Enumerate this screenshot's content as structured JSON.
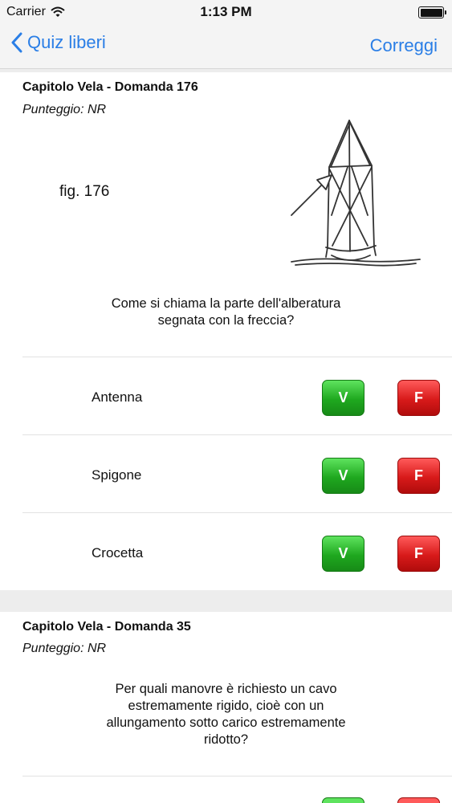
{
  "status_bar": {
    "carrier": "Carrier",
    "time": "1:13 PM"
  },
  "nav": {
    "back_label": "Quiz liberi",
    "right_label": "Correggi"
  },
  "questions": [
    {
      "title": "Capitolo Vela - Domanda 176",
      "score": "Punteggio: NR",
      "figure_label": "fig. 176",
      "question_lines": [
        "Come si chiama la parte dell'alberatura",
        "segnata con la freccia?"
      ],
      "answers": [
        {
          "label": "Antenna",
          "true_label": "V",
          "false_label": "F"
        },
        {
          "label": "Spigone",
          "true_label": "V",
          "false_label": "F"
        },
        {
          "label": "Crocetta",
          "true_label": "V",
          "false_label": "F"
        }
      ]
    },
    {
      "title": "Capitolo Vela - Domanda 35",
      "score": "Punteggio: NR",
      "question_lines": [
        "Per quali manovre è richiesto un cavo",
        "estremamente rigido, cioè con un",
        "allungamento sotto carico estremamente",
        "ridotto?"
      ]
    }
  ],
  "colors": {
    "accent": "#2a7ee6",
    "true_button": "#22a822",
    "false_button": "#d81a1a"
  },
  "icons": {
    "signal": "wifi-icon",
    "battery": "battery-icon",
    "back": "chevron-left-icon",
    "figure": "mast-diagram"
  }
}
